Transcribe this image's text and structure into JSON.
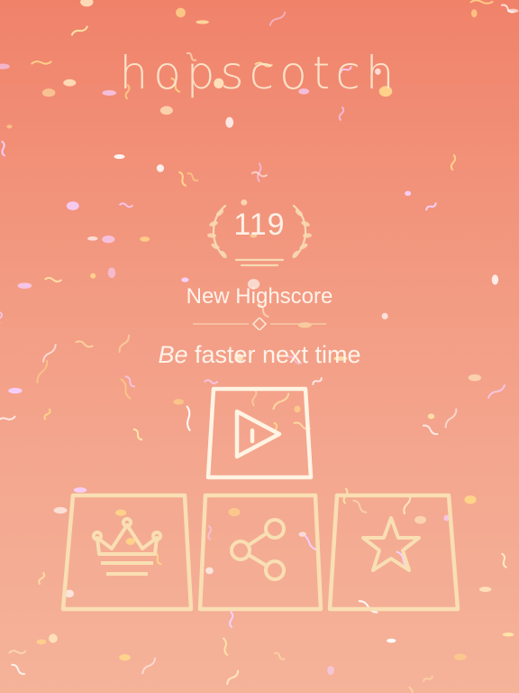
{
  "game": {
    "title": "hopscotch",
    "score": "119",
    "highscore_label": "New Highscore",
    "message_prefix": "Be",
    "message_rest": " faster next time"
  },
  "buttons": {
    "play": {
      "icon": "play-icon"
    },
    "leaderboard": {
      "icon": "crown-icon"
    },
    "share": {
      "icon": "share-icon"
    },
    "rate": {
      "icon": "star-icon"
    }
  },
  "colors": {
    "background_top": "#f0826a",
    "background_bottom": "#f5b39a",
    "text": "#fff3ea",
    "button_outline": "#fff1dc",
    "button_outline_muted": "#f8dcae"
  }
}
